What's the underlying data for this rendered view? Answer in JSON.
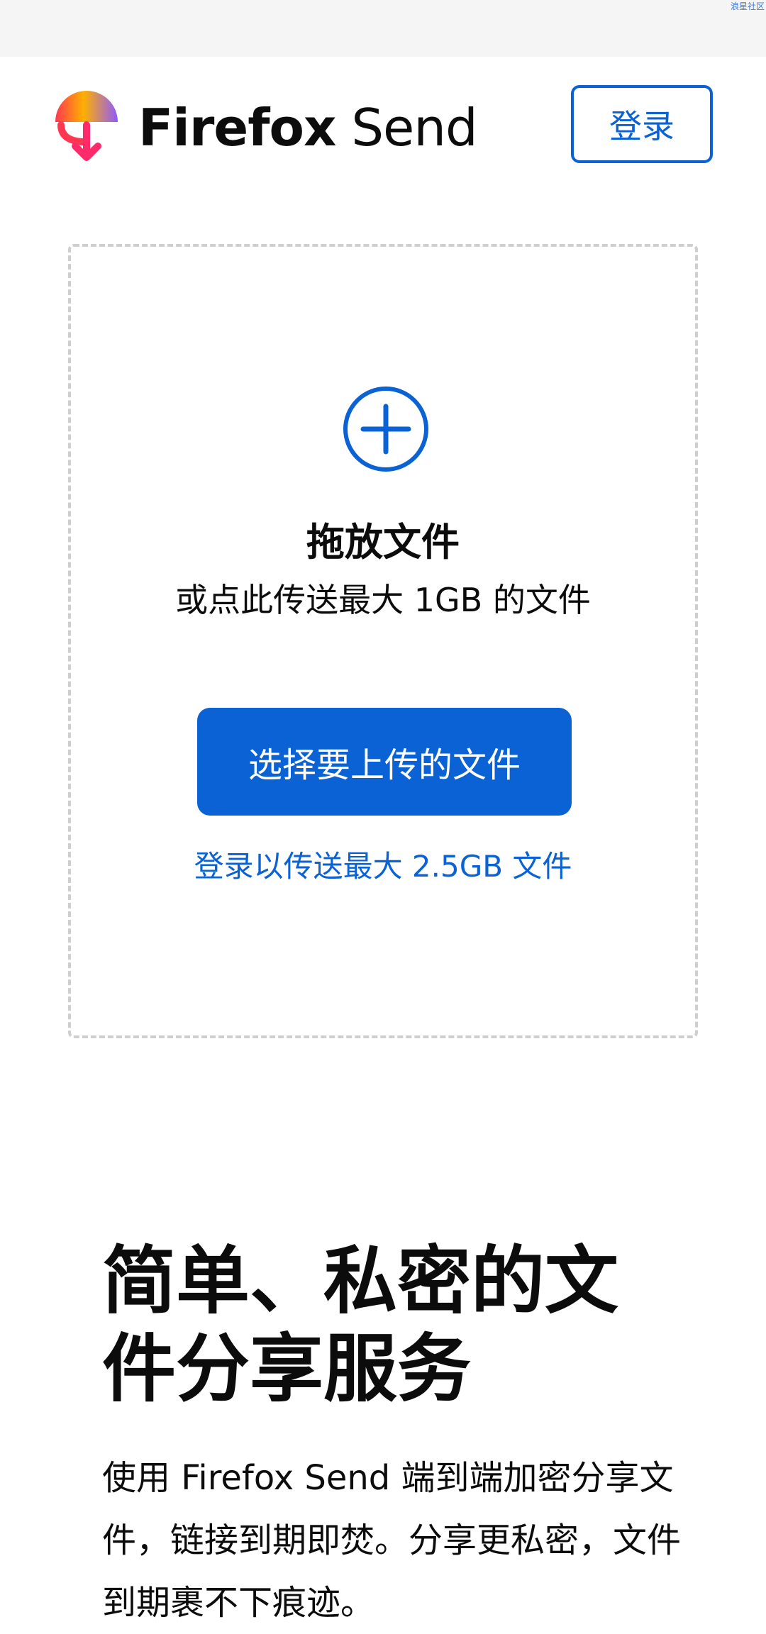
{
  "watermark": "浪星社区",
  "header": {
    "brand_bold": "Firefox",
    "brand_light": " Send",
    "signin_label": "登录"
  },
  "upload": {
    "title": "拖放文件",
    "subtitle": "或点此传送最大 1GB 的文件",
    "choose_button": "选择要上传的文件",
    "signin_link": "登录以传送最大 2.5GB 文件"
  },
  "intro": {
    "headline": "简单、私密的文件分享服务",
    "description": "使用 Firefox Send 端到端加密分享文件，链接到期即焚。分享更私密，文件到期裹不下痕迹。"
  },
  "colors": {
    "accent": "#0a62d4",
    "dashed_border": "#cfcfd1",
    "status_bar": "#f5f5f5"
  },
  "icons": [
    "firefox-send-logo",
    "plus-circle-icon"
  ]
}
